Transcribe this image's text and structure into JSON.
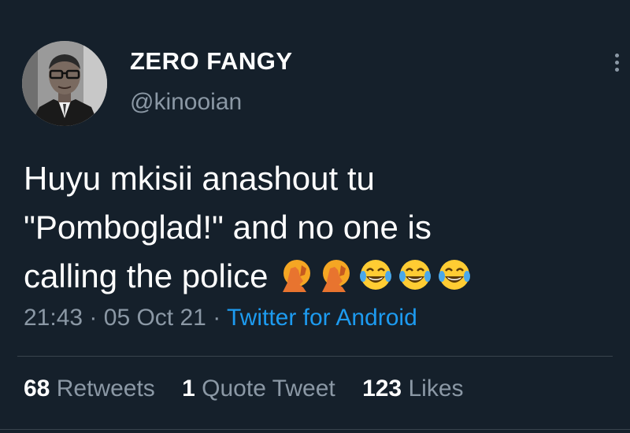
{
  "author": {
    "display_name": "ZERO FANGY",
    "handle": "@kinooian"
  },
  "tweet": {
    "text_lines": [
      "Huyu mkisii anashout tu",
      "\"Pomboglad!\" and no one is",
      "calling the police"
    ],
    "emojis": [
      "facepalm-emoji",
      "facepalm-emoji",
      "tears-of-joy-emoji",
      "tears-of-joy-emoji",
      "tears-of-joy-emoji"
    ],
    "time": "21:43",
    "date": "05 Oct 21",
    "separator": "·",
    "source": "Twitter for Android"
  },
  "stats": {
    "retweets_count": "68",
    "retweets_label": "Retweets",
    "quotes_count": "1",
    "quotes_label": "Quote Tweet",
    "likes_count": "123",
    "likes_label": "Likes"
  },
  "colors": {
    "background": "#15202b",
    "primary_text": "#ffffff",
    "secondary_text": "#8b98a5",
    "link": "#1d9bf0",
    "divider": "#38444d"
  }
}
